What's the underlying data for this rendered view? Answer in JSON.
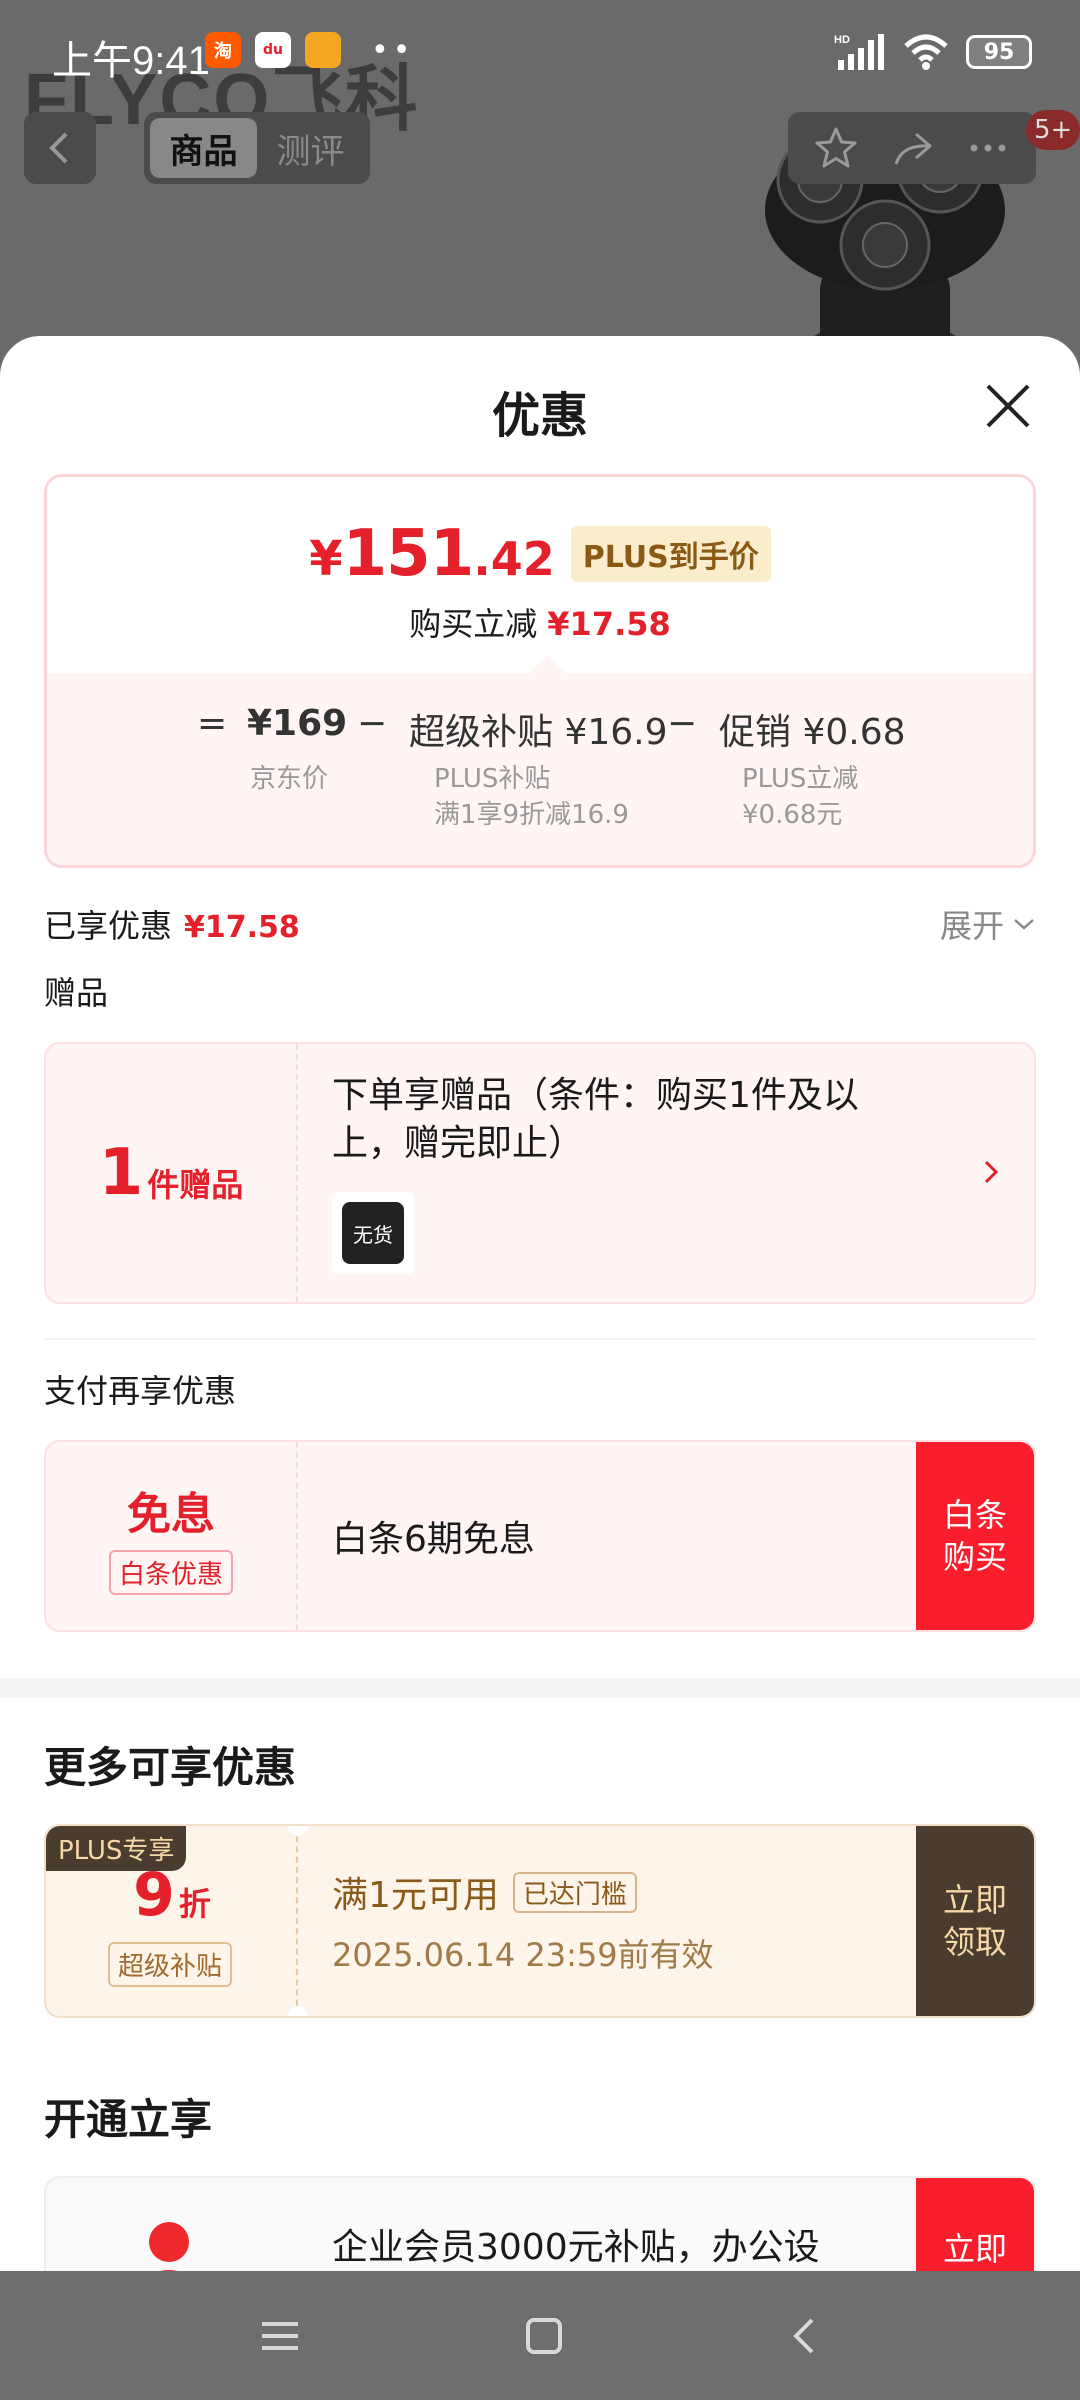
{
  "status_bar": {
    "time": "上午9:41",
    "apps": [
      {
        "icon": "taobao-icon",
        "label": "淘",
        "color": "#ff5a00"
      },
      {
        "icon": "map-icon",
        "label": "du",
        "color": "#ffffff"
      },
      {
        "icon": "note-icon",
        "label": "",
        "color": "#f5a623"
      }
    ],
    "more": "••",
    "network": "HD",
    "battery": "95"
  },
  "background_page": {
    "brand": "FLYCO飞科",
    "tabs": [
      {
        "label": "商品",
        "active": true
      },
      {
        "label": "测评",
        "active": false
      }
    ],
    "badge": "5+"
  },
  "sheet": {
    "title": "优惠",
    "price_card": {
      "currency": "¥",
      "price_int": "151",
      "price_dec": ".42",
      "plus_tag": "PLUS到手价",
      "sub_label": "购买立减",
      "sub_value": "¥17.58",
      "formula": {
        "equals": "=",
        "base": "¥169",
        "minus1": "−",
        "subsidy": "超级补贴 ¥16.9",
        "minus2": "−",
        "promo": "促销 ¥0.68"
      },
      "formula_notes": {
        "base_note": "京东价",
        "subsidy_note_1": "PLUS补贴",
        "subsidy_note_2": "满1享9折减16.9",
        "promo_note_1": "PLUS立减",
        "promo_note_2": "¥0.68元"
      }
    },
    "enjoyed": {
      "label": "已享优惠",
      "value": "¥17.58",
      "expand": "展开"
    },
    "gift_section": {
      "label": "赠品",
      "count": "1",
      "unit": "件赠品",
      "text": "下单享赠品（条件：购买1件及以上，赠完即止）",
      "thumb_label": "无货"
    },
    "pay_section": {
      "label": "支付再享优惠",
      "big": "免息",
      "tag": "白条优惠",
      "text": "白条6期免息",
      "button": "白条购买"
    },
    "more_section": {
      "label": "更多可享优惠",
      "plus_exclusive": "PLUS专享",
      "discount_num": "9",
      "discount_unit": "折",
      "tag": "超级补贴",
      "condition": "满1元可用",
      "reached": "已达门槛",
      "date": "2025.06.14 23:59前有效",
      "button": "立即领取"
    },
    "open_section": {
      "label": "开通立享",
      "text": "企业会员3000元补贴，办公设",
      "button": "立即"
    }
  },
  "colors": {
    "accent_red": "#e4202b",
    "button_red": "#fa1e2d",
    "plus_brown": "#4b3c30",
    "plus_gold": "#f5d9a8"
  }
}
